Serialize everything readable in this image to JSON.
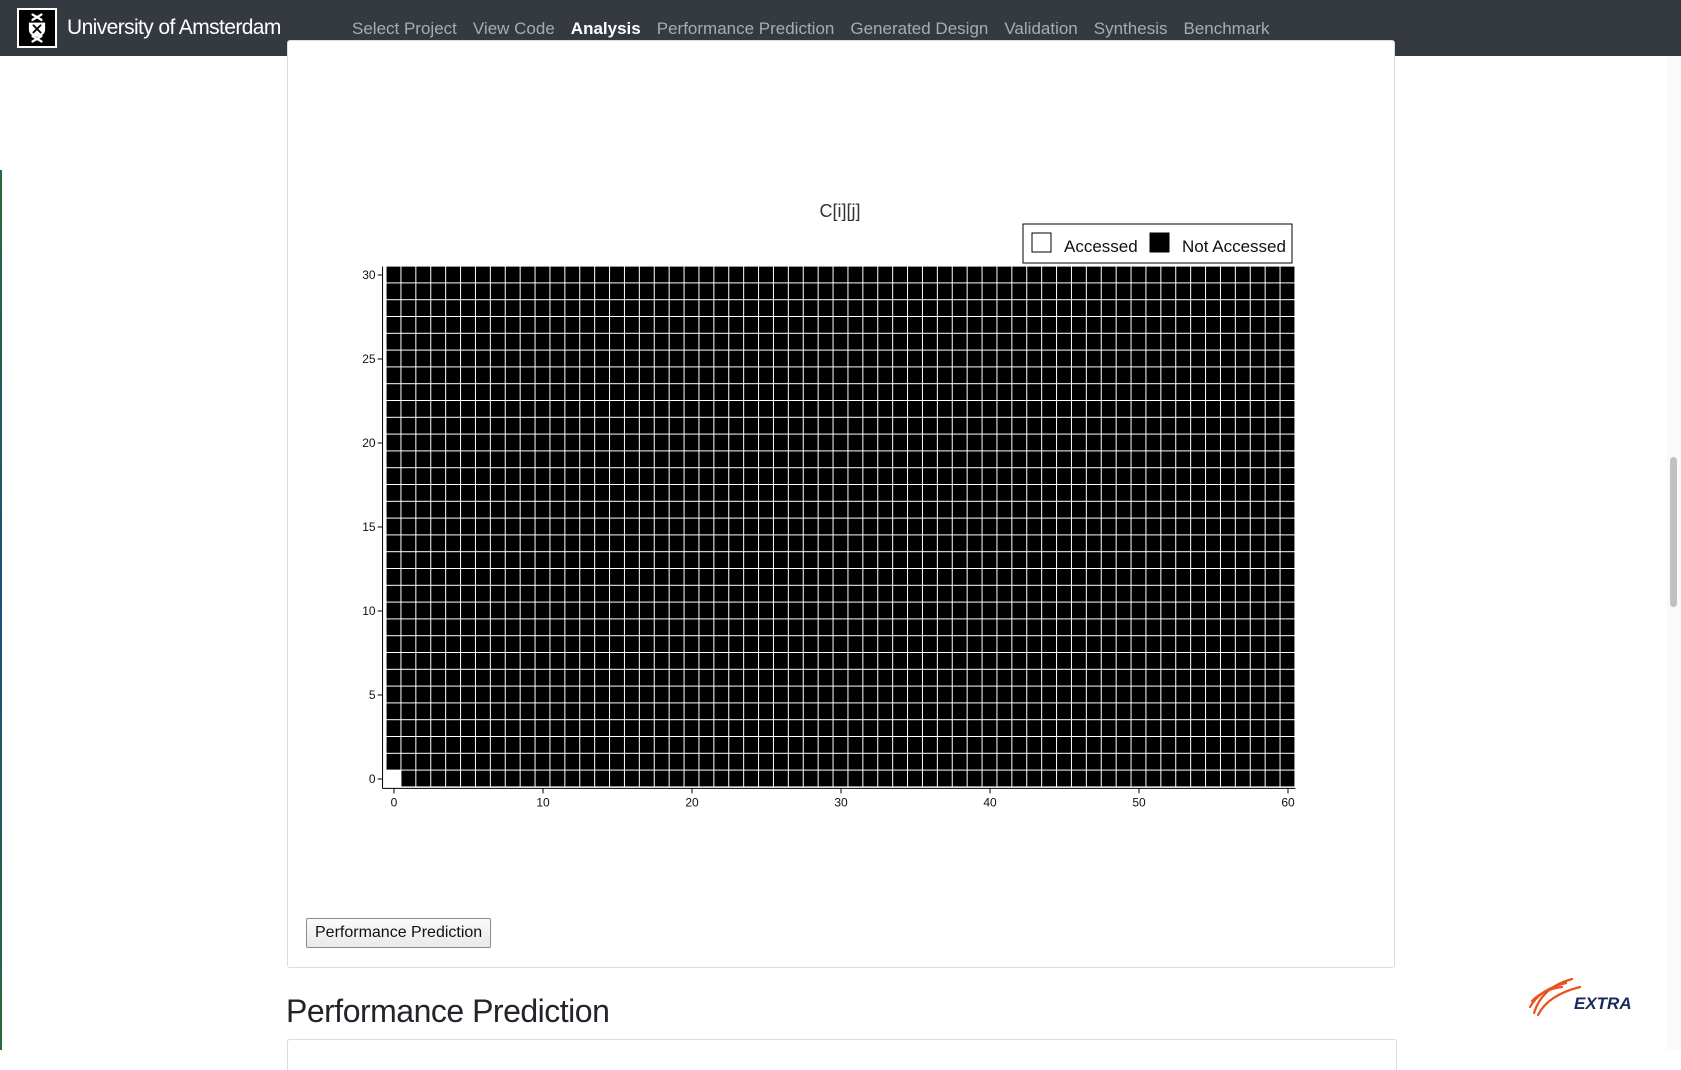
{
  "navbar": {
    "brand": "University of Amsterdam",
    "links": [
      {
        "label": "Select Project",
        "active": false
      },
      {
        "label": "View Code",
        "active": false
      },
      {
        "label": "Analysis",
        "active": true
      },
      {
        "label": "Performance Prediction",
        "active": false
      },
      {
        "label": "Generated Design",
        "active": false
      },
      {
        "label": "Validation",
        "active": false
      },
      {
        "label": "Synthesis",
        "active": false
      },
      {
        "label": "Benchmark",
        "active": false
      }
    ]
  },
  "chart_data": {
    "type": "heatmap",
    "title": "C[i][j]",
    "legend": {
      "placement": "top-right",
      "entries": [
        {
          "label": "Accessed",
          "color": "#ffffff"
        },
        {
          "label": "Not Accessed",
          "color": "#000000"
        }
      ]
    },
    "xlim": [
      0,
      60
    ],
    "ylim": [
      0,
      30
    ],
    "x_ticks": [
      "0",
      "10",
      "20",
      "30",
      "40",
      "50",
      "60"
    ],
    "y_ticks": [
      "0",
      "5",
      "10",
      "15",
      "20",
      "25",
      "30"
    ],
    "column_groups": [
      [
        0
      ],
      [
        1,
        2,
        3,
        4
      ],
      [
        5,
        6,
        7,
        8
      ],
      [
        9,
        10,
        11,
        12
      ],
      [
        13,
        14,
        15,
        16
      ],
      [
        17,
        18,
        19,
        20
      ],
      [
        21,
        22,
        23,
        24
      ],
      [
        25,
        26,
        27,
        28
      ],
      [
        29,
        30,
        31,
        32
      ],
      [
        33,
        34,
        35,
        36
      ],
      [
        37,
        38,
        39,
        40
      ],
      [
        41,
        42,
        43,
        44
      ],
      [
        45,
        46,
        47,
        48
      ],
      [
        49,
        50,
        51,
        52
      ],
      [
        53,
        54,
        55,
        56
      ],
      [
        57,
        58,
        59,
        60
      ]
    ],
    "rows": 31,
    "accessed_cells": [
      [
        0,
        0
      ]
    ],
    "grid": false
  },
  "actions": {
    "performance_button": "Performance Prediction"
  },
  "section": {
    "title": "Performance Prediction"
  },
  "footer": {
    "logo_text": "EXTRA"
  },
  "colors": {
    "navbar_bg": "#343a40",
    "nav_inactive": "#a8acb0",
    "nav_active": "#ffffff",
    "accent_orange": "#e8531f"
  }
}
